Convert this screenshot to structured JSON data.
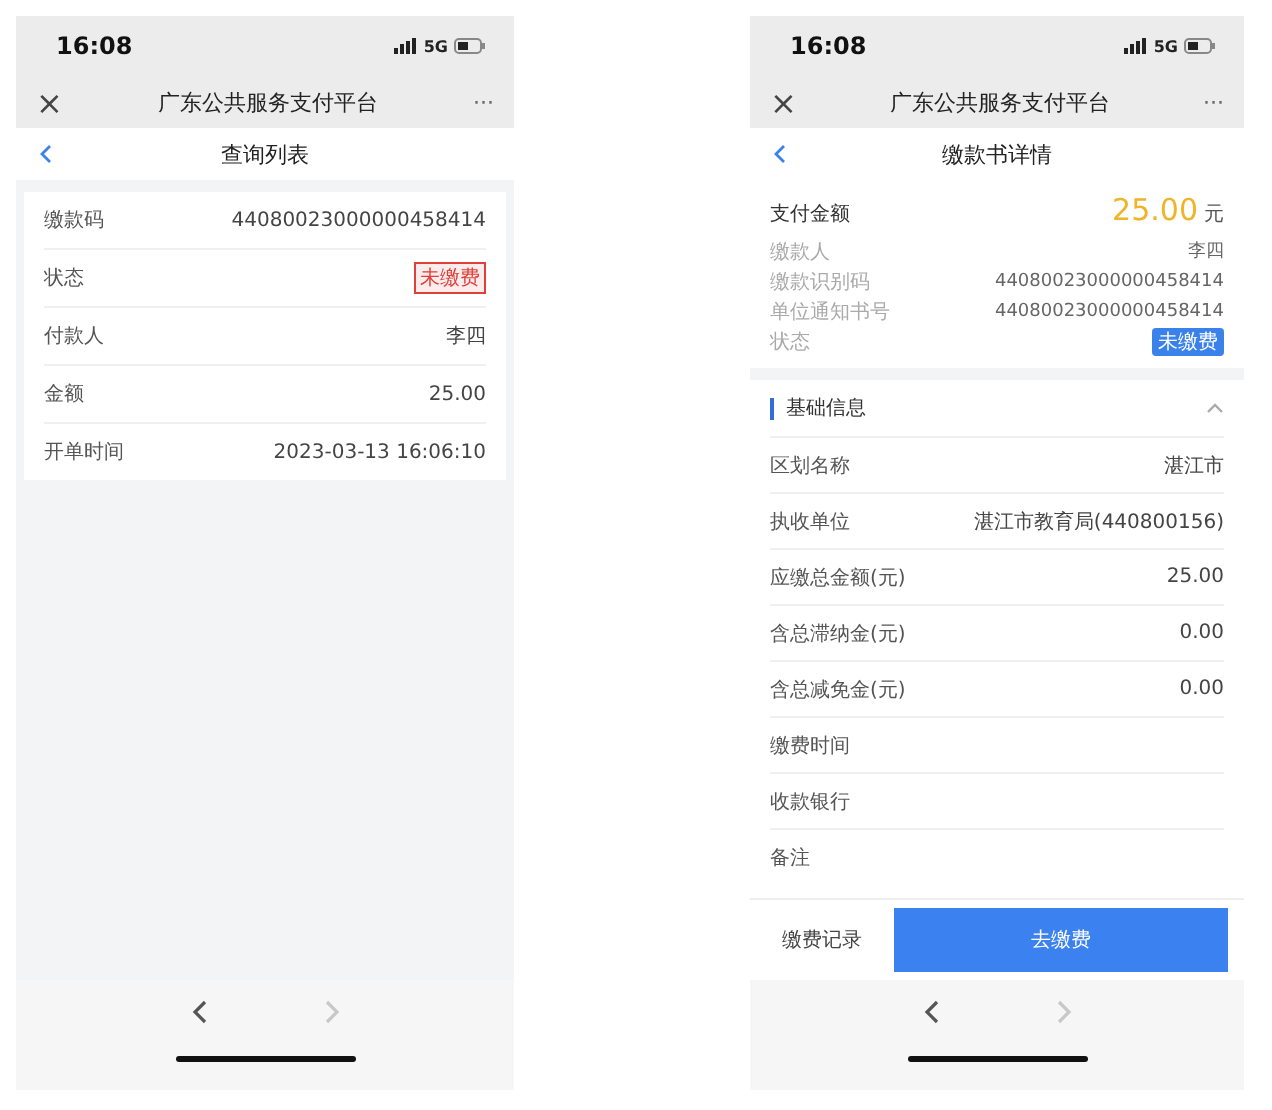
{
  "left_screen": {
    "status_bar": {
      "time": "16:08",
      "network": "5G"
    },
    "app_bar": {
      "close": "×",
      "title": "广东公共服务支付平台",
      "more": "···"
    },
    "page_title": "查询列表",
    "rows": [
      {
        "kind": "text",
        "label": "缴款码",
        "value": "44080023000000458414"
      },
      {
        "kind": "tag",
        "label": "状态",
        "value": "未缴费"
      },
      {
        "kind": "text",
        "label": "付款人",
        "value": "李四"
      },
      {
        "kind": "text",
        "label": "金额",
        "value": "25.00"
      },
      {
        "kind": "text",
        "label": "开单时间",
        "value": "2023-03-13 16:06:10"
      }
    ],
    "browser_nav": {
      "back_disabled": false,
      "forward_disabled": true
    }
  },
  "right_screen": {
    "status_bar": {
      "time": "16:08",
      "network": "5G"
    },
    "app_bar": {
      "close": "×",
      "title": "广东公共服务支付平台",
      "more": "···"
    },
    "page_title": "缴款书详情",
    "summary": {
      "amount_label": "支付金额",
      "amount": "25.00",
      "currency": "元",
      "rows": [
        {
          "kind": "text",
          "label": "缴款人",
          "value": "李四"
        },
        {
          "kind": "text",
          "label": "缴款识别码",
          "value": "44080023000000458414"
        },
        {
          "kind": "text",
          "label": "单位通知书号",
          "value": "44080023000000458414"
        },
        {
          "kind": "chip",
          "label": "状态",
          "value": "未缴费"
        }
      ]
    },
    "section": {
      "title": "基础信息",
      "expanded": true,
      "rows": [
        {
          "label": "区划名称",
          "value": "湛江市"
        },
        {
          "label": "执收单位",
          "value": "湛江市教育局(440800156)"
        },
        {
          "label": "应缴总金额(元)",
          "value": "25.00"
        },
        {
          "label": "含总滞纳金(元)",
          "value": "0.00"
        },
        {
          "label": "含总减免金(元)",
          "value": "0.00"
        },
        {
          "label": "缴费时间"
        },
        {
          "label": "收款银行"
        },
        {
          "label": "备注"
        }
      ]
    },
    "actions": {
      "secondary": "缴费记录",
      "primary": "去缴费"
    },
    "browser_nav": {
      "back_disabled": false,
      "forward_disabled": true
    }
  }
}
